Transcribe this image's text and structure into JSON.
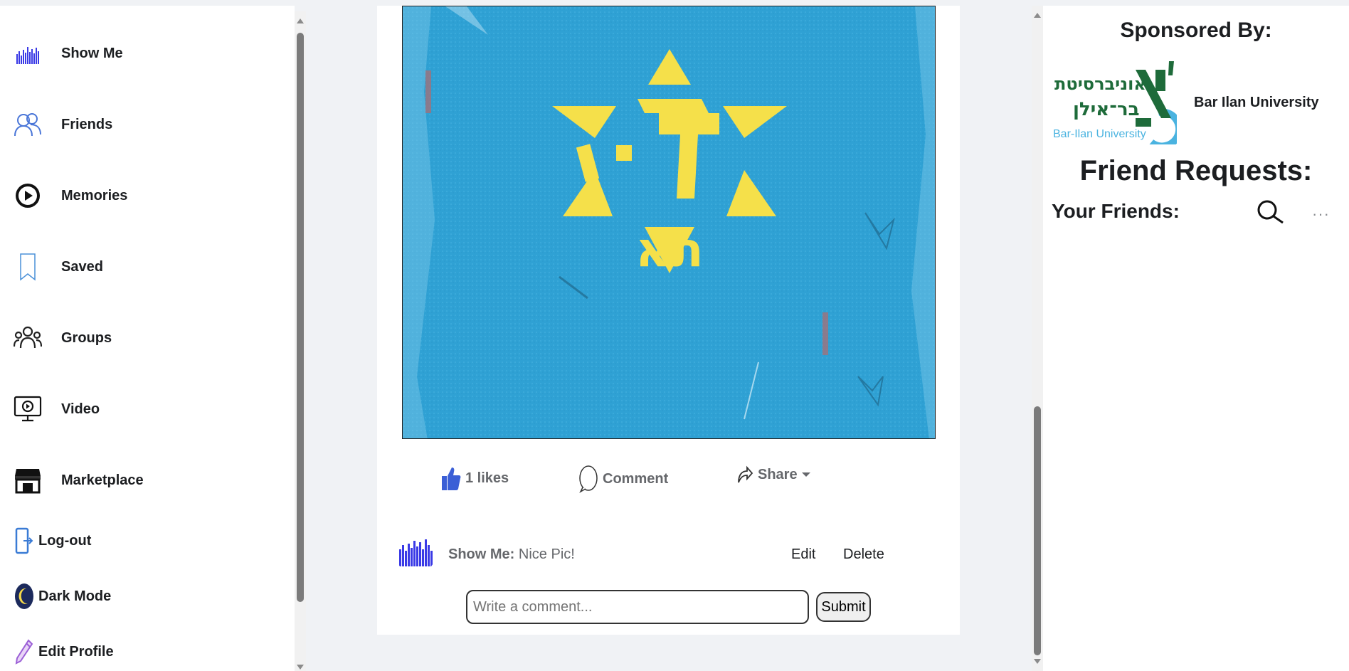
{
  "sidebar": {
    "items": [
      {
        "label": "Show Me",
        "icon": "profile-chart-icon"
      },
      {
        "label": "Friends",
        "icon": "friends-icon"
      },
      {
        "label": "Memories",
        "icon": "memories-clock-icon"
      },
      {
        "label": "Saved",
        "icon": "bookmark-icon"
      },
      {
        "label": "Groups",
        "icon": "groups-icon"
      },
      {
        "label": "Video",
        "icon": "video-monitor-icon"
      },
      {
        "label": "Marketplace",
        "icon": "store-icon"
      },
      {
        "label": "Log-out",
        "icon": "logout-door-icon"
      },
      {
        "label": "Dark Mode",
        "icon": "moon-icon"
      },
      {
        "label": "Edit Profile",
        "icon": "pencil-icon"
      }
    ]
  },
  "post": {
    "image_text": "תא",
    "likes_label": "1 likes",
    "comment_label": "Comment",
    "share_label": "Share",
    "comment": {
      "author": "Show Me:",
      "text": "Nice Pic!",
      "edit_label": "Edit",
      "delete_label": "Delete"
    },
    "comment_placeholder": "Write a comment...",
    "submit_label": "Submit"
  },
  "right": {
    "sponsored_title": "Sponsored By:",
    "sponsor_name": "Bar Ilan University",
    "sponsor_logo_hebrew_1": "אוניברסיטת",
    "sponsor_logo_hebrew_2": "בר־אילן",
    "sponsor_logo_english": "Bar-Ilan University",
    "friend_requests_title": "Friend Requests:",
    "your_friends_label": "Your Friends:",
    "more_label": "···"
  },
  "colors": {
    "like_blue": "#3b5fd6",
    "poster_blue": "#2fa1d4",
    "star_yellow": "#f5e04a",
    "bar_blue": "#3a3ae6",
    "logo_green": "#1e6b3a",
    "logo_cyan": "#4ab3e0"
  }
}
